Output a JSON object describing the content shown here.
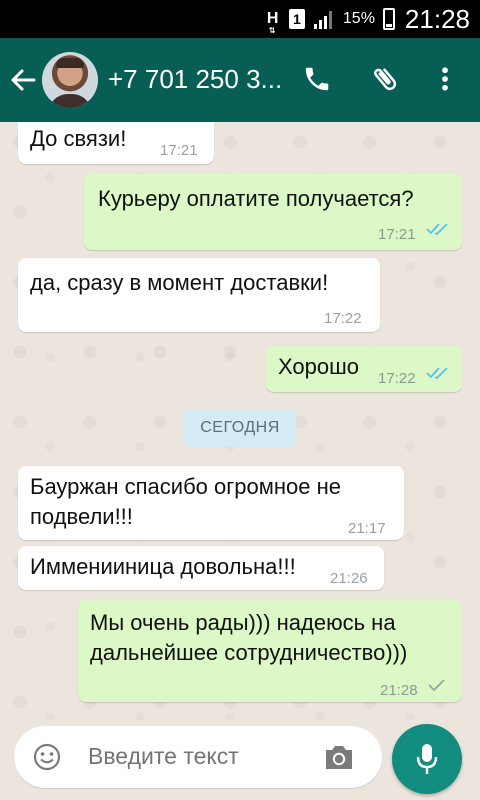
{
  "status_bar": {
    "network_letter": "H",
    "sim_slot": "1",
    "battery": "15%",
    "time": "21:28"
  },
  "header": {
    "contact_name": "+7 701 250 3...",
    "icons": [
      "back-arrow-icon",
      "avatar",
      "phone-icon",
      "attach-clip-icon",
      "more-vert-icon"
    ],
    "colors": {
      "bar": "#075e54",
      "accent": "#128c7e"
    }
  },
  "messages": [
    {
      "dir": "in",
      "lines": [
        "До связи!"
      ],
      "time": "17:21"
    },
    {
      "dir": "out",
      "lines": [
        "Курьеру оплатите получается?"
      ],
      "time": "17:21",
      "status": "read"
    },
    {
      "dir": "in",
      "lines": [
        "да, сразу в момент доставки!"
      ],
      "time": "17:22"
    },
    {
      "dir": "out",
      "lines": [
        "Хорошо"
      ],
      "time": "17:22",
      "status": "read"
    },
    {
      "dir": "in",
      "lines": [
        "Бауржан спасибо огромное не",
        "подвели!!!"
      ],
      "time": "21:17"
    },
    {
      "dir": "in",
      "lines": [
        "Имменииница довольна!!!"
      ],
      "time": "21:26"
    },
    {
      "dir": "out",
      "lines": [
        "Мы очень рады))) надеюсь на",
        "дальнейшее сотрудничество)))"
      ],
      "time": "21:28",
      "status": "sent"
    }
  ],
  "date_separator": "СЕГОДНЯ",
  "composer": {
    "placeholder": "Введите текст"
  },
  "colors": {
    "incoming_bubble": "#ffffff",
    "outgoing_bubble": "#dcf8c6",
    "read_tick": "#4fc3f7",
    "sent_tick": "#9aa79c"
  }
}
